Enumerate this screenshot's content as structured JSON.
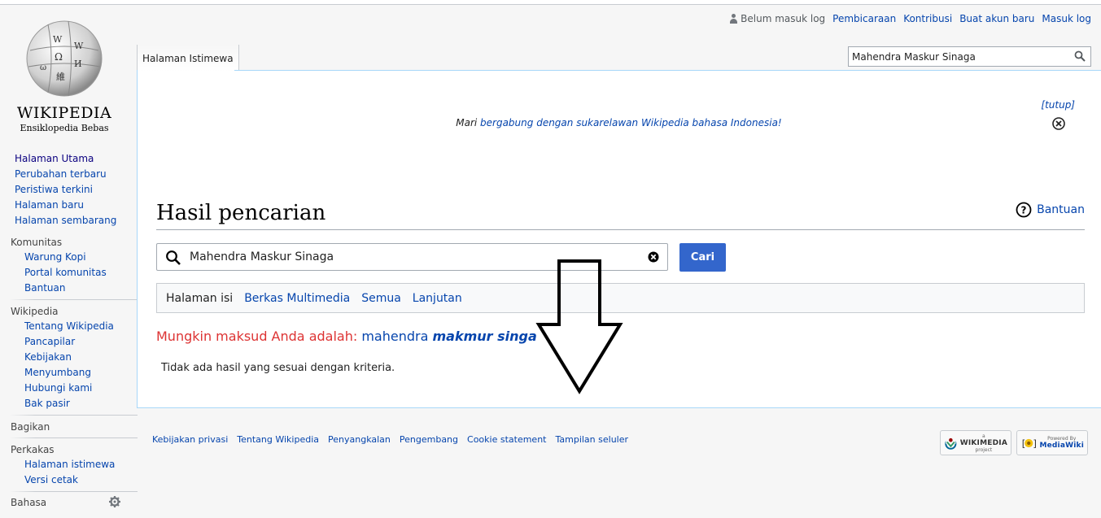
{
  "logo": {
    "wordmark": "WIKIPEDIA",
    "tagline": "Ensiklopedia Bebas"
  },
  "sidebar": {
    "main": [
      "Halaman Utama",
      "Perubahan terbaru",
      "Peristiwa terkini",
      "Halaman baru",
      "Halaman sembarang"
    ],
    "komunitas": {
      "head": "Komunitas",
      "items": [
        "Warung Kopi",
        "Portal komunitas",
        "Bantuan"
      ]
    },
    "wikipedia": {
      "head": "Wikipedia",
      "items": [
        "Tentang Wikipedia",
        "Pancapilar",
        "Kebijakan",
        "Menyumbang",
        "Hubungi kami",
        "Bak pasir"
      ]
    },
    "bagikan": {
      "head": "Bagikan"
    },
    "perkakas": {
      "head": "Perkakas",
      "items": [
        "Halaman istimewa",
        "Versi cetak"
      ]
    },
    "bahasa": {
      "head": "Bahasa"
    }
  },
  "personal": {
    "user": "Belum masuk log",
    "links": [
      "Pembicaraan",
      "Kontribusi",
      "Buat akun baru",
      "Masuk log"
    ]
  },
  "tab": {
    "label": "Halaman Istimewa"
  },
  "topsearch": {
    "value": "Mahendra Maskur Sinaga"
  },
  "notice": {
    "prefix": "Mari ",
    "link": "bergabung dengan sukarelawan Wikipedia bahasa Indonesia!",
    "close_label": "[tutup]"
  },
  "page": {
    "title": "Hasil pencarian",
    "help": "Bantuan"
  },
  "search": {
    "value": "Mahendra Maskur Sinaga",
    "button": "Cari"
  },
  "profiles": [
    "Halaman isi",
    "Berkas Multimedia",
    "Semua",
    "Lanjutan"
  ],
  "suggestion": {
    "label": "Mungkin maksud Anda adalah:",
    "plain": "mahendra",
    "bold": "makmur singa"
  },
  "noresult": "Tidak ada hasil yang sesuai dengan kriteria.",
  "footer": [
    "Kebijakan privasi",
    "Tentang Wikipedia",
    "Penyangkalan",
    "Pengembang",
    "Cookie statement",
    "Tampilan seluler"
  ],
  "badges": {
    "wikimedia": {
      "small": "a",
      "brand": "WIKIMEDIA",
      "sub": "project"
    },
    "mediawiki": {
      "small": "Powered By",
      "brand": "MediaWiki"
    }
  },
  "colors": {
    "link": "#0645ad",
    "button": "#3366cc",
    "suggest_label": "#dd3333"
  }
}
